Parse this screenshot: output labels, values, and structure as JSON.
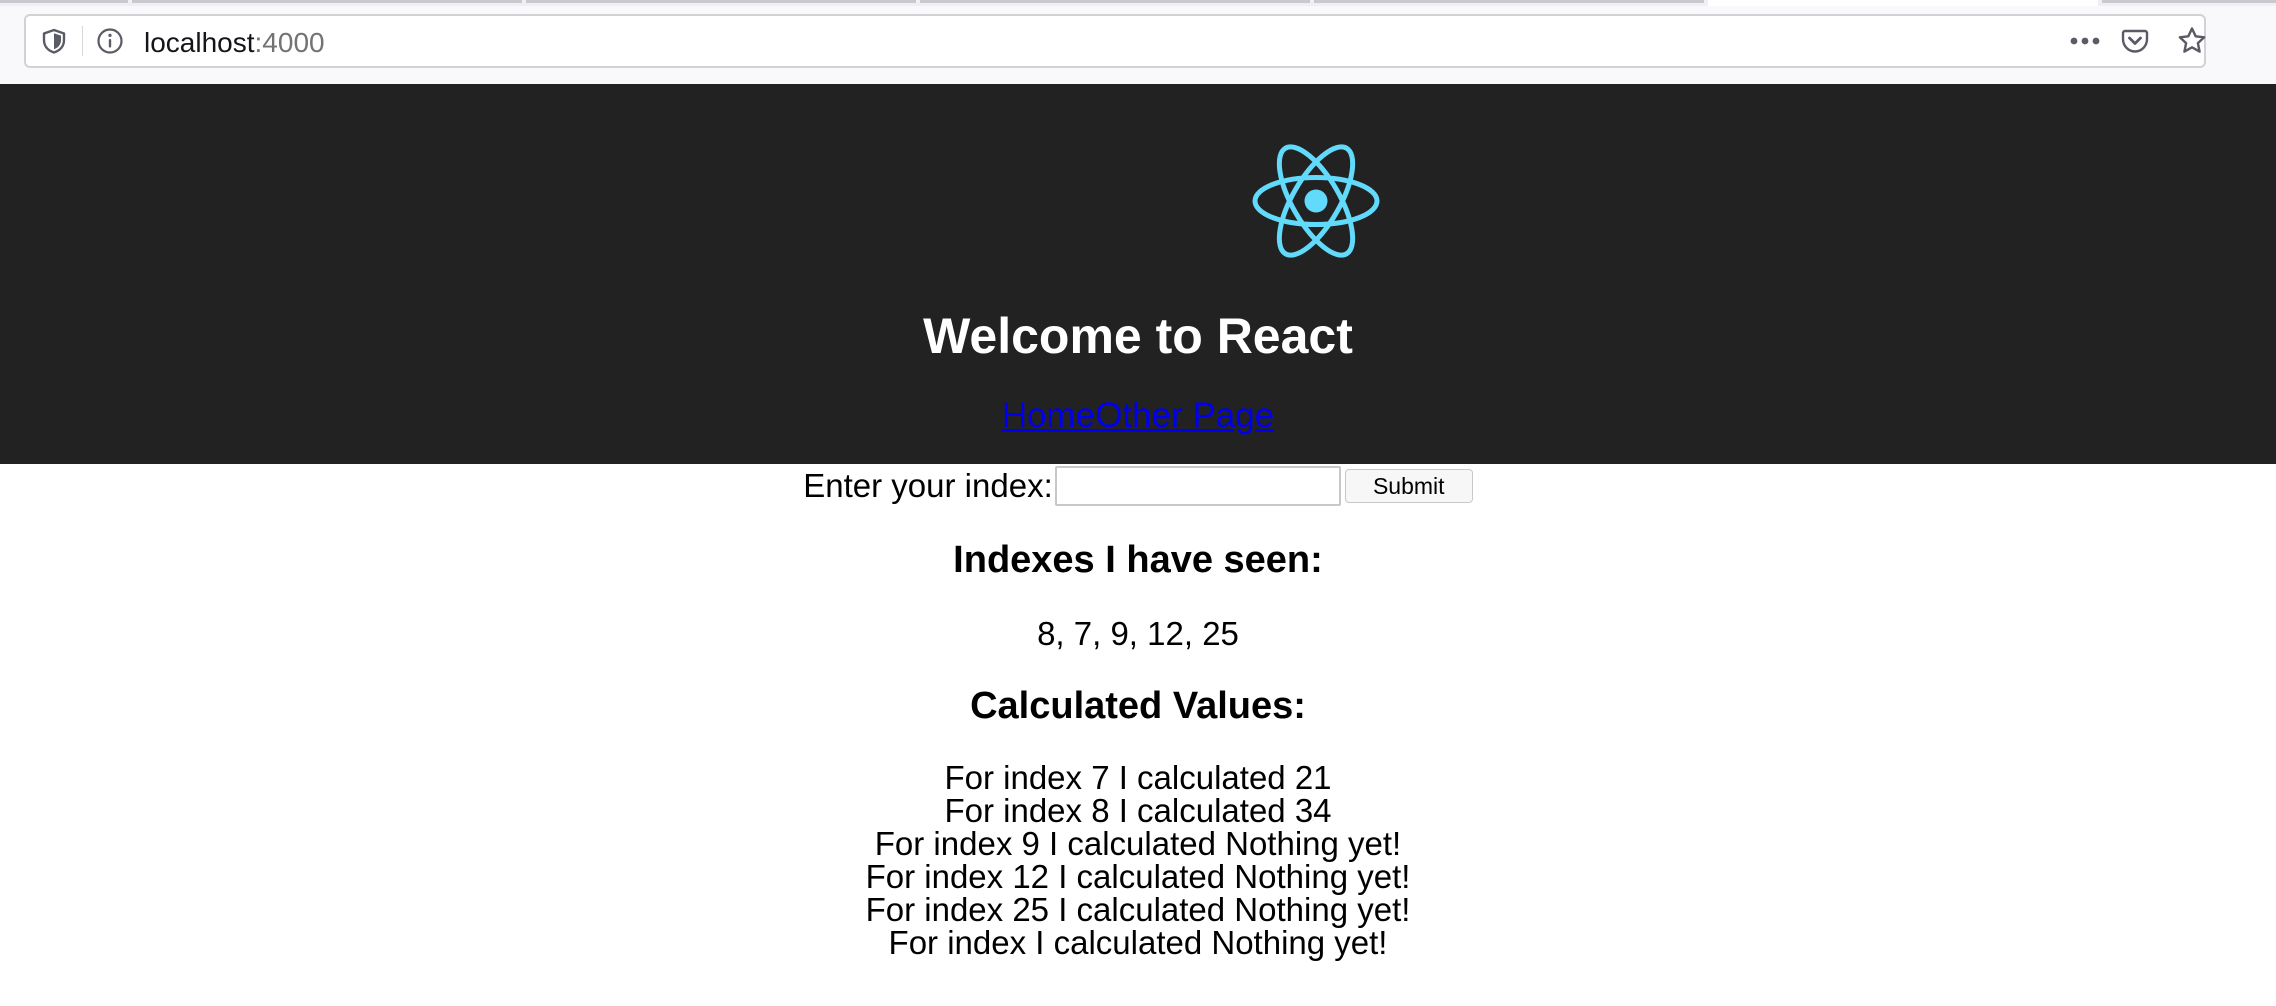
{
  "browser": {
    "url_host": "localhost",
    "url_port": ":4000"
  },
  "header": {
    "title": "Welcome to React",
    "nav": {
      "home": "Home",
      "other": "Other Page"
    },
    "logo_color": "#61dafb",
    "background": "#222222"
  },
  "form": {
    "label": "Enter your index:",
    "input_value": "",
    "submit_label": "Submit"
  },
  "seen": {
    "heading": "Indexes I have seen:",
    "values": "8, 7, 9, 12, 25"
  },
  "calculated": {
    "heading": "Calculated Values:",
    "items": [
      "For index 7 I calculated 21",
      "For index 8 I calculated 34",
      "For index 9 I calculated Nothing yet!",
      "For index 12 I calculated Nothing yet!",
      "For index 25 I calculated Nothing yet!",
      "For index I calculated Nothing yet!"
    ]
  }
}
